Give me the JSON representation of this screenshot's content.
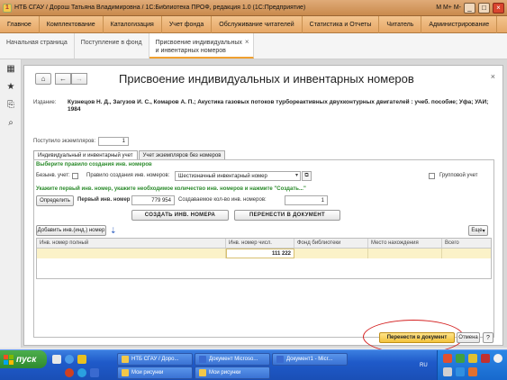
{
  "window": {
    "title": "НТБ СГАУ / Дорош Татьяна Владимировна / 1С:Библиотека ПРОФ, редакция 1.0 (1С:Предприятие)",
    "tray_letters": "M M+ M-"
  },
  "menu": [
    "Главное",
    "Комплектование",
    "Каталогизация",
    "Учет фонда",
    "Обслуживание читателей",
    "Статистика и Отчеты",
    "Читатель",
    "Администрирование"
  ],
  "tabs": [
    {
      "label": "Начальная страница"
    },
    {
      "label": "Поступление в фонд"
    },
    {
      "label": "Присвоение индивидуальных и инвентарных номеров"
    }
  ],
  "form": {
    "title": "Присвоение индивидуальных и инвентарных номеров",
    "edition_label": "Издание:",
    "edition_text": "Кузнецов Н. Д., Загузов И. С., Комаров А. П.; Акустика газовых потоков турбореактивных двухконтурных двигателей : учеб. пособие; Уфа; УАИ; 1984",
    "received_label": "Поступило экземпляров:",
    "received_value": "1",
    "subtabs": [
      "Индивидуальный и инвентарный учет",
      "Учет экземпляров без номеров"
    ],
    "rule_heading": "Выберите правило создания инв. номеров",
    "no_account_label": "Безынв. учет:",
    "rule_label": "Правило создания инв. номеров:",
    "rule_value": "Шестизначный инвентарный номер",
    "group_label": "Групповой учет",
    "hint": "Укажите первый инв. номер, укажите необходимое количество инв. номеров и нажмите \"Создать...\"",
    "define_button": "Определить",
    "first_number_label": "Первый инв. номер",
    "first_number_value": "779 954",
    "count_label": "Создаваемое кол-во инв. номеров:",
    "count_value": "1",
    "create_button": "СОЗДАТЬ ИНВ. НОМЕРА",
    "transfer_button": "ПЕРЕНЕСТИ В ДОКУМЕНТ",
    "add_button": "Добавить инв.(инд.) номер",
    "more_button": "Еще",
    "grid_headers": [
      "Инв. номер полный",
      "Инв. номер числ.",
      "Фонд библиотеки",
      "Место нахождения",
      "Всего"
    ],
    "grid_rows": [
      {
        "full": "",
        "num": "111 222",
        "fund": "",
        "place": "",
        "total": ""
      }
    ],
    "ok_button": "Перенести в документ",
    "cancel_button": "Отмена",
    "help_button": "?"
  },
  "taskbar": {
    "start": "пуск",
    "items": [
      "НТБ СГАУ / Доро...",
      "Документ Microso...",
      "Документ1 - Micr...",
      "Мои рисунки",
      "Мои рисунки"
    ],
    "lang": "RU"
  },
  "colors": {
    "accent": "#f0a030",
    "green_label": "#2a8a2a",
    "ok_button": "#f2c23c",
    "highlight_ellipse": "#d42020"
  }
}
